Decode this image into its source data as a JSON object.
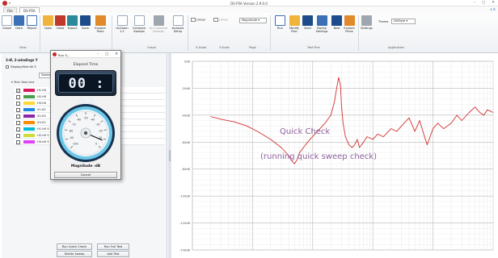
{
  "window": {
    "title": "DV-FRA Version 2.9.0.0",
    "quick_access": "▾",
    "controls": [
      "–",
      "▢",
      "✕"
    ]
  },
  "tabs": {
    "file": "File",
    "active": "DV-FRA",
    "right_info": "ℹ ⚙"
  },
  "ribbon": {
    "buttons": [
      {
        "label": "Graph",
        "icon": "graph-icon"
      },
      {
        "label": "Data",
        "icon": "data-icon"
      },
      {
        "label": "Report",
        "icon": "report-icon"
      },
      {
        "label": "Open",
        "icon": "open-folder-icon"
      },
      {
        "label": "Close",
        "icon": "close-icon"
      },
      {
        "label": "Export",
        "icon": "export-icon"
      },
      {
        "label": "Save",
        "icon": "save-icon"
      },
      {
        "label": "Explore\nTests",
        "icon": "explore-tests-icon"
      },
      {
        "label": "UnZoom\n1:1",
        "icon": "unzoom-icon"
      },
      {
        "label": "Compare\nSweeps",
        "icon": "compare-sweeps-icon"
      },
      {
        "label": "Un-Compare\nSweeps",
        "icon": "uncompare-sweeps-icon"
      },
      {
        "label": "Analysis\nSetup",
        "icon": "analysis-setup-icon"
      },
      {
        "label": "Run",
        "icon": "run-icon"
      },
      {
        "label": "Modify\nPlan",
        "icon": "modify-plan-icon"
      },
      {
        "label": "Save",
        "icon": "save-plan-icon"
      },
      {
        "label": "Sweep\nSettings",
        "icon": "sweep-settings-icon"
      },
      {
        "label": "New",
        "icon": "new-plan-icon"
      },
      {
        "label": "Explore\nPlans",
        "icon": "explore-plans-icon"
      },
      {
        "label": "Settings",
        "icon": "settings-icon"
      }
    ],
    "linear_x": "Linear",
    "linear_y": "Linear",
    "page_select": "Magnitude",
    "theme_label": "Theme",
    "theme_select": "DXStyle",
    "groups": [
      "View",
      "Graph",
      "X-Scale",
      "Y-Scale",
      "Page",
      "Test Plan",
      "Application"
    ]
  },
  "left_panel": {
    "title": "3-Ø, 2-windings Y",
    "display_all": "Display/Hide All S",
    "sweep_select": "Sweep S",
    "test_label": "▾ Test: New test",
    "rows": [
      {
        "label": "H1-H0",
        "color": "#d81b60",
        "checked": true
      },
      {
        "label": "H2-H0",
        "color": "#43a047",
        "checked": false
      },
      {
        "label": "H3-H0",
        "color": "#fdd835",
        "checked": false
      },
      {
        "label": "X1-X2",
        "color": "#1e88e5",
        "checked": false
      },
      {
        "label": "X2-X3",
        "color": "#8e24aa",
        "checked": false
      },
      {
        "label": "X3-X1",
        "color": "#fb8c00",
        "checked": false
      },
      {
        "label": "H1-H0 S",
        "color": "#00bcd4",
        "checked": false
      },
      {
        "label": "H2-H0 S",
        "color": "#cddc39",
        "checked": false
      },
      {
        "label": "H3-H0 S",
        "color": "#e040fb",
        "checked": false
      }
    ],
    "buttons": {
      "run_quick_check": "Run Quick Check",
      "run_full_test": "Run Full Test",
      "delete_sweep": "Delete Sweep",
      "add_test": "Add Test"
    }
  },
  "dialog": {
    "title": "Run S...",
    "controls": [
      "–",
      "▢",
      "✕"
    ],
    "elapsed_label": "Elapsed Time",
    "elapsed_value": "00 : 04",
    "gauge_ticks": [
      "-100",
      "-90",
      "-80",
      "-70",
      "-60",
      "-50",
      "-40",
      "-30",
      "-20",
      "-10",
      "0"
    ],
    "gauge_value": -8,
    "magnitude_label": "Magnitude  -dB",
    "cancel": "Cancel"
  },
  "plot": {
    "overlay_title": "Quick Check",
    "overlay_subtitle": "(running quick sweep check)",
    "y_ticks": [
      "0dB",
      "-20dB",
      "-40dB",
      "-60dB",
      "-80dB",
      "-100dB",
      "-120dB",
      "-140dB"
    ],
    "trace_color": "#d32f2f"
  },
  "chart_data": {
    "type": "line",
    "xscale": "log",
    "ylim": [
      -140,
      0
    ],
    "series": [
      {
        "x": [
          20,
          30,
          50,
          80,
          120,
          200,
          300,
          400,
          450,
          500,
          550,
          600,
          700,
          900,
          1200,
          1600,
          2000,
          2300,
          2500,
          2700,
          2900,
          3000,
          3200,
          3500,
          4000,
          4500,
          5000,
          5500,
          6000,
          7000,
          8000,
          10000,
          12000,
          15000,
          20000,
          25000,
          30000,
          40000,
          50000,
          60000,
          70000,
          80000,
          100000,
          120000,
          150000,
          200000,
          250000,
          300000,
          400000,
          500000,
          600000,
          700000,
          800000,
          1000000
        ],
        "y": [
          -41,
          -43,
          -45,
          -48,
          -52,
          -58,
          -64,
          -70,
          -74,
          -76,
          -73,
          -68,
          -64,
          -58,
          -52,
          -46,
          -40,
          -30,
          -20,
          -12,
          -18,
          -32,
          -46,
          -56,
          -62,
          -64,
          -62,
          -58,
          -64,
          -60,
          -56,
          -58,
          -54,
          -56,
          -50,
          -52,
          -48,
          -42,
          -52,
          -44,
          -54,
          -62,
          -50,
          -46,
          -50,
          -46,
          -40,
          -44,
          -38,
          -34,
          -38,
          -40,
          -36,
          -38
        ]
      }
    ]
  }
}
